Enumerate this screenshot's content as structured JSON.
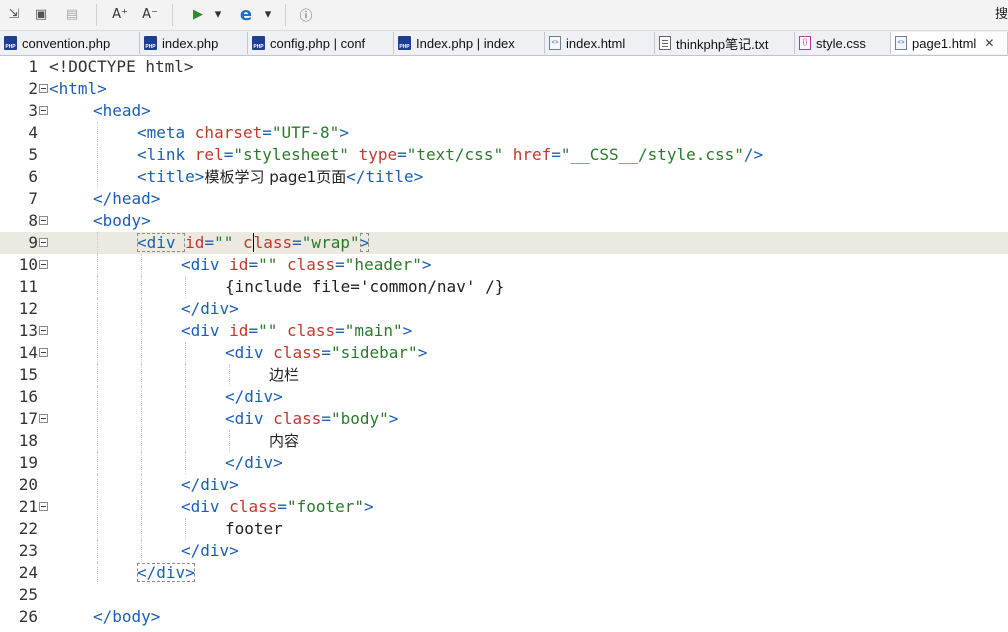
{
  "toolbar": {
    "buttons": [
      {
        "name": "toolbar-import-icon",
        "glyph": "⇲",
        "interactable": true
      },
      {
        "name": "toolbar-save-icon",
        "glyph": "▣",
        "interactable": true
      },
      {
        "name": "toolbar-export-icon",
        "glyph": "▤",
        "interactable": true
      },
      {
        "name": "font-increase-icon",
        "glyph": "A⁺",
        "interactable": true
      },
      {
        "name": "font-decrease-icon",
        "glyph": "A⁻",
        "interactable": true
      },
      {
        "name": "run-icon",
        "glyph": "▶",
        "interactable": true
      },
      {
        "name": "run-dropdown-icon",
        "glyph": "▾",
        "interactable": true
      },
      {
        "name": "browser-edge-icon",
        "glyph": "e",
        "interactable": true
      },
      {
        "name": "browser-dropdown-icon",
        "glyph": "▾",
        "interactable": true
      },
      {
        "name": "info-icon",
        "glyph": "ⓘ",
        "interactable": true
      }
    ],
    "search_label": "搜"
  },
  "tabs": [
    {
      "label": "convention.php",
      "icon": "php",
      "active": false
    },
    {
      "label": "index.php",
      "icon": "php",
      "active": false
    },
    {
      "label": "config.php | conf",
      "icon": "php",
      "active": false
    },
    {
      "label": "Index.php | index",
      "icon": "php",
      "active": false
    },
    {
      "label": "index.html",
      "icon": "html",
      "active": false
    },
    {
      "label": "thinkphp笔记.txt",
      "icon": "txt",
      "active": false
    },
    {
      "label": "style.css",
      "icon": "css",
      "active": false
    },
    {
      "label": "page1.html",
      "icon": "html",
      "active": true,
      "close": "✕"
    }
  ],
  "editor": {
    "current_line": 9,
    "lines": [
      {
        "n": "1",
        "fold": false,
        "indent": 0,
        "tokens": [
          [
            "t-doc",
            "<!DOCTYPE html>"
          ]
        ]
      },
      {
        "n": "2",
        "fold": true,
        "indent": 0,
        "tokens": [
          [
            "t-tag",
            "<html>"
          ]
        ]
      },
      {
        "n": "3",
        "fold": true,
        "indent": 1,
        "tokens": [
          [
            "t-tag",
            "<head>"
          ]
        ]
      },
      {
        "n": "4",
        "fold": false,
        "indent": 2,
        "tokens": [
          [
            "t-tag",
            "<meta "
          ],
          [
            "t-attr",
            "charset"
          ],
          [
            "t-tag",
            "="
          ],
          [
            "t-str",
            "\"UTF-8\""
          ],
          [
            "t-tag",
            ">"
          ]
        ]
      },
      {
        "n": "5",
        "fold": false,
        "indent": 2,
        "tokens": [
          [
            "t-tag",
            "<link "
          ],
          [
            "t-attr",
            "rel"
          ],
          [
            "t-tag",
            "="
          ],
          [
            "t-str",
            "\"stylesheet\""
          ],
          [
            "t-tag",
            " "
          ],
          [
            "t-attr",
            "type"
          ],
          [
            "t-tag",
            "="
          ],
          [
            "t-str",
            "\"text/css\""
          ],
          [
            "t-tag",
            " "
          ],
          [
            "t-attr",
            "href"
          ],
          [
            "t-tag",
            "="
          ],
          [
            "t-str",
            "\"__CSS__/style.css\""
          ],
          [
            "t-tag",
            "/>"
          ]
        ]
      },
      {
        "n": "6",
        "fold": false,
        "indent": 2,
        "tokens": [
          [
            "t-tag",
            "<title>"
          ],
          [
            "t-txt cjk",
            "模板学习 page1页面"
          ],
          [
            "t-tag",
            "</title>"
          ]
        ]
      },
      {
        "n": "7",
        "fold": false,
        "indent": 1,
        "tokens": [
          [
            "t-tag",
            "</head>"
          ]
        ]
      },
      {
        "n": "8",
        "fold": true,
        "indent": 1,
        "tokens": [
          [
            "t-tag",
            "<body>"
          ]
        ]
      },
      {
        "n": "9",
        "fold": true,
        "indent": 2,
        "tokens": [
          [
            "t-tag boxed",
            "<div "
          ],
          [
            "t-attr",
            "id"
          ],
          [
            "t-tag",
            "="
          ],
          [
            "t-str",
            "\"\""
          ],
          [
            "t-tag",
            " "
          ],
          [
            "t-attr",
            "c"
          ],
          [
            "caret",
            ""
          ],
          [
            "t-attr",
            "lass"
          ],
          [
            "t-tag",
            "="
          ],
          [
            "t-str",
            "\"wrap\""
          ],
          [
            "t-tag boxed",
            ">"
          ]
        ]
      },
      {
        "n": "10",
        "fold": true,
        "indent": 3,
        "tokens": [
          [
            "t-tag",
            "<div "
          ],
          [
            "t-attr",
            "id"
          ],
          [
            "t-tag",
            "="
          ],
          [
            "t-str",
            "\"\""
          ],
          [
            "t-tag",
            " "
          ],
          [
            "t-attr",
            "class"
          ],
          [
            "t-tag",
            "="
          ],
          [
            "t-str",
            "\"header\""
          ],
          [
            "t-tag",
            ">"
          ]
        ]
      },
      {
        "n": "11",
        "fold": false,
        "indent": 4,
        "tokens": [
          [
            "t-txt",
            "{include file='common/nav' /}"
          ]
        ]
      },
      {
        "n": "12",
        "fold": false,
        "indent": 3,
        "tokens": [
          [
            "t-tag",
            "</div>"
          ]
        ]
      },
      {
        "n": "13",
        "fold": true,
        "indent": 3,
        "tokens": [
          [
            "t-tag",
            "<div "
          ],
          [
            "t-attr",
            "id"
          ],
          [
            "t-tag",
            "="
          ],
          [
            "t-str",
            "\"\""
          ],
          [
            "t-tag",
            " "
          ],
          [
            "t-attr",
            "class"
          ],
          [
            "t-tag",
            "="
          ],
          [
            "t-str",
            "\"main\""
          ],
          [
            "t-tag",
            ">"
          ]
        ]
      },
      {
        "n": "14",
        "fold": true,
        "indent": 4,
        "tokens": [
          [
            "t-tag",
            "<div "
          ],
          [
            "t-attr",
            "class"
          ],
          [
            "t-tag",
            "="
          ],
          [
            "t-str",
            "\"sidebar\""
          ],
          [
            "t-tag",
            ">"
          ]
        ]
      },
      {
        "n": "15",
        "fold": false,
        "indent": 5,
        "tokens": [
          [
            "t-txt cjk",
            "边栏"
          ]
        ]
      },
      {
        "n": "16",
        "fold": false,
        "indent": 4,
        "tokens": [
          [
            "t-tag",
            "</div>"
          ]
        ]
      },
      {
        "n": "17",
        "fold": true,
        "indent": 4,
        "tokens": [
          [
            "t-tag",
            "<div "
          ],
          [
            "t-attr",
            "class"
          ],
          [
            "t-tag",
            "="
          ],
          [
            "t-str",
            "\"body\""
          ],
          [
            "t-tag",
            ">"
          ]
        ]
      },
      {
        "n": "18",
        "fold": false,
        "indent": 5,
        "tokens": [
          [
            "t-txt cjk",
            "内容"
          ]
        ]
      },
      {
        "n": "19",
        "fold": false,
        "indent": 4,
        "tokens": [
          [
            "t-tag",
            "</div>"
          ]
        ]
      },
      {
        "n": "20",
        "fold": false,
        "indent": 3,
        "tokens": [
          [
            "t-tag",
            "</div>"
          ]
        ]
      },
      {
        "n": "21",
        "fold": true,
        "indent": 3,
        "tokens": [
          [
            "t-tag",
            "<div "
          ],
          [
            "t-attr",
            "class"
          ],
          [
            "t-tag",
            "="
          ],
          [
            "t-str",
            "\"footer\""
          ],
          [
            "t-tag",
            ">"
          ]
        ]
      },
      {
        "n": "22",
        "fold": false,
        "indent": 4,
        "tokens": [
          [
            "t-txt",
            "footer"
          ]
        ]
      },
      {
        "n": "23",
        "fold": false,
        "indent": 3,
        "tokens": [
          [
            "t-tag",
            "</div>"
          ]
        ]
      },
      {
        "n": "24",
        "fold": false,
        "indent": 2,
        "tokens": [
          [
            "t-tag boxed",
            "</div>"
          ]
        ]
      },
      {
        "n": "25",
        "fold": false,
        "indent": 0,
        "tokens": []
      },
      {
        "n": "26",
        "fold": false,
        "indent": 1,
        "tokens": [
          [
            "t-tag",
            "</body>"
          ]
        ]
      }
    ]
  }
}
